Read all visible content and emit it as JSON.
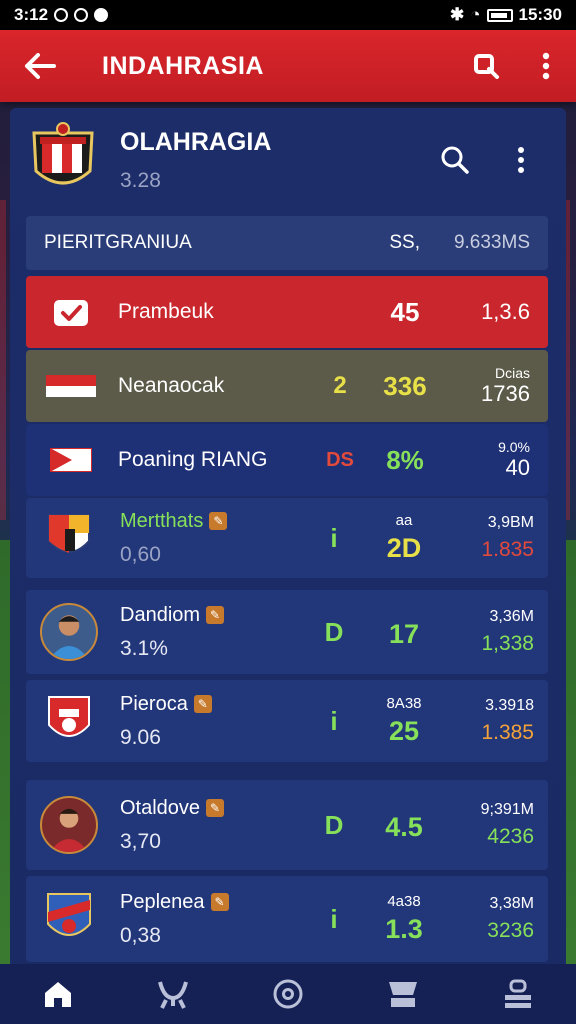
{
  "status_bar": {
    "time_left": "3:12",
    "time_right": "15:30"
  },
  "app_bar": {
    "title": "INDAHRASIA"
  },
  "team": {
    "name": "OLAHRAGIA",
    "sub": "3.28"
  },
  "table_header": {
    "label": "PIERITGRANIUA",
    "col1": "SS,",
    "col2": "9.633MS"
  },
  "rows": [
    {
      "name": "Prambeuk",
      "v1": "",
      "v2": "45",
      "v3": "1,3.6",
      "v3_small": ""
    },
    {
      "name": "Neanaocak",
      "v1": "2",
      "v2": "336",
      "v3": "1736",
      "v3_small": "Dcias"
    },
    {
      "name": "Poaning RIANG",
      "v1": "DS",
      "v2": "8%",
      "v3": "40",
      "v3_small": "9.0%"
    }
  ],
  "cards": [
    {
      "name": "Mertthats",
      "value": "0,60",
      "col_a": "i",
      "col_b_top": "aa",
      "col_b": "2D",
      "col_c_top": "3,9BM",
      "col_c": "1.835"
    },
    {
      "name": "Dandiom",
      "value": "3.1%",
      "col_a": "D",
      "col_b_top": "",
      "col_b": "17",
      "col_c_top": "3,36M",
      "col_c": "1,338"
    },
    {
      "name": "Pieroca",
      "value": "9.06",
      "col_a": "i",
      "col_b_top": "8A38",
      "col_b": "25",
      "col_c_top": "3.3918",
      "col_c": "1.385"
    },
    {
      "name": "Otaldove",
      "value": "3,70",
      "col_a": "D",
      "col_b_top": "",
      "col_b": "4.5",
      "col_c_top": "9;391M",
      "col_c": "4236"
    },
    {
      "name": "Peplenea",
      "value": "0,38",
      "col_a": "i",
      "col_b_top": "4a38",
      "col_b": "1.3",
      "col_c_top": "3,38M",
      "col_c": "3236"
    }
  ],
  "colors": {
    "accent_red": "#d9262b",
    "green_value": "#86e05a",
    "yellow_value": "#e8e048",
    "red_value": "#e24a3b",
    "orange_value": "#f3a23a"
  },
  "nav": [
    "home-icon",
    "trophy-icon",
    "ball-icon",
    "stats-icon",
    "profile-icon"
  ]
}
